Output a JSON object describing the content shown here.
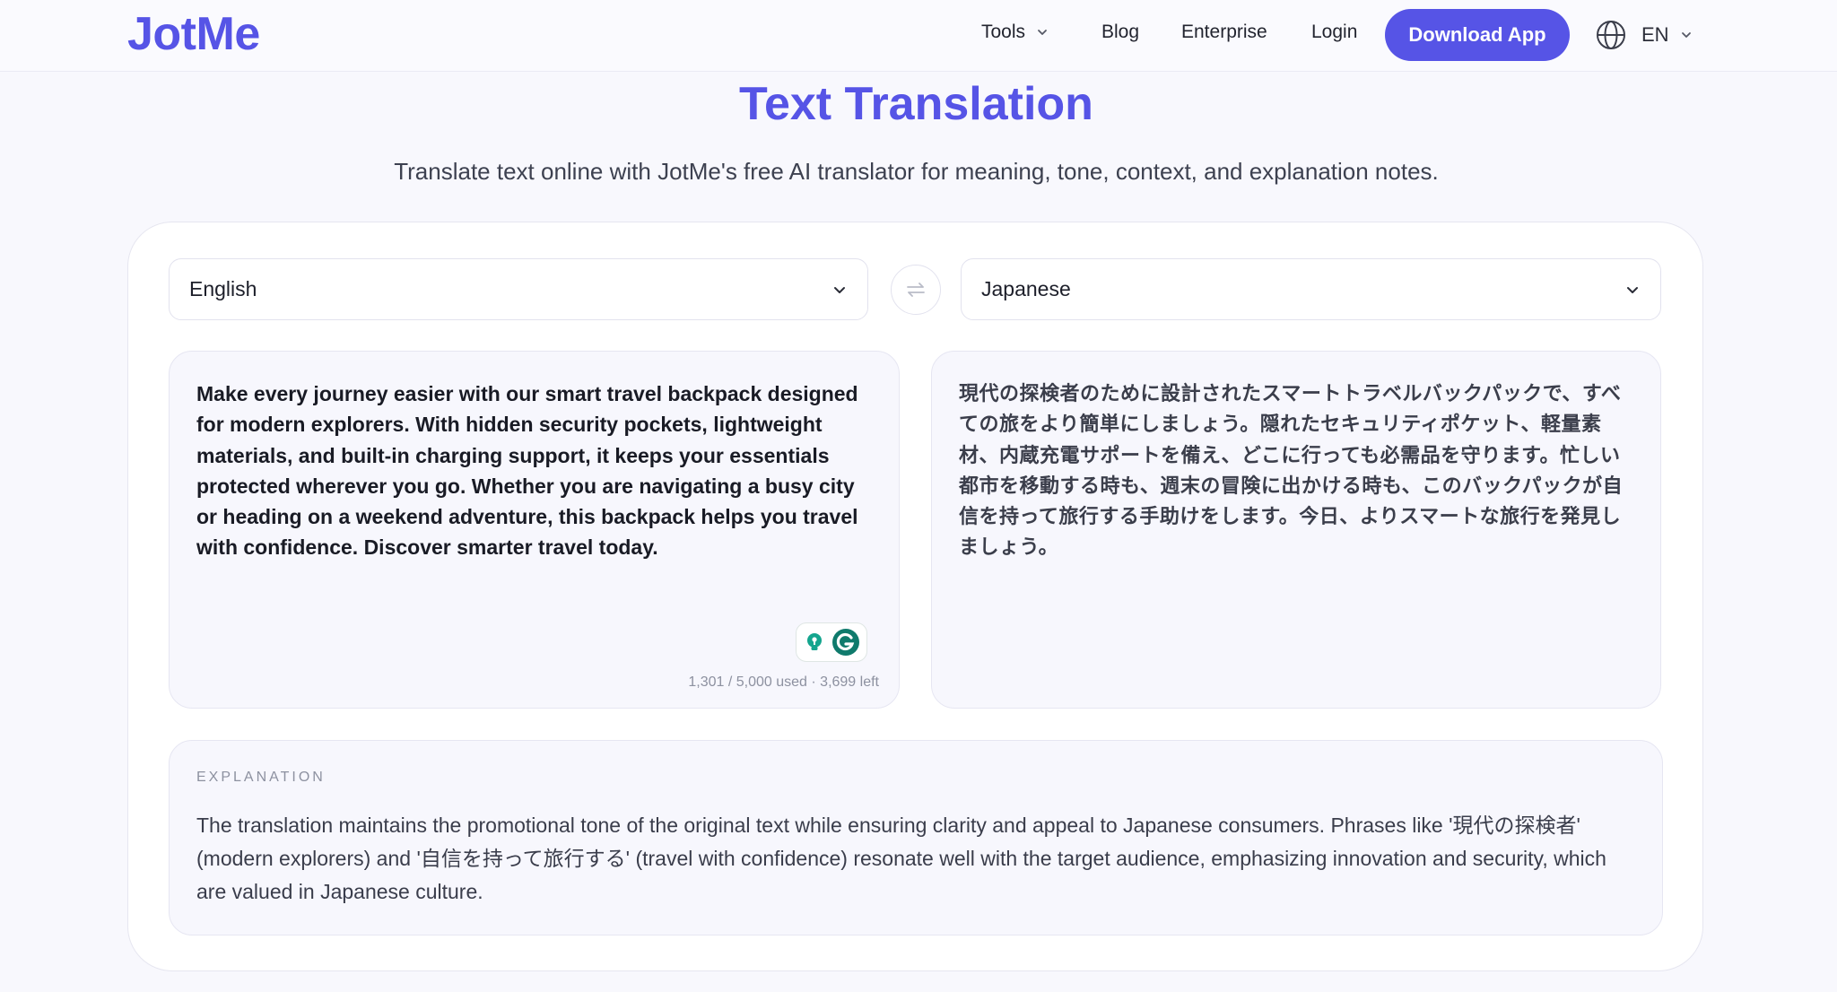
{
  "header": {
    "logo": "JotMe",
    "nav": {
      "tools": "Tools",
      "blog": "Blog",
      "enterprise": "Enterprise",
      "login": "Login"
    },
    "download_label": "Download App",
    "language_code": "EN"
  },
  "hero": {
    "title": "Text Translation",
    "subtitle": "Translate text online with JotMe's free AI translator for meaning, tone, context, and explanation notes."
  },
  "translator": {
    "source_language": "English",
    "target_language": "Japanese",
    "source_text": "Make every journey easier with our smart travel backpack designed for modern explorers. With hidden security pockets, lightweight materials, and built-in charging support, it keeps your essentials protected wherever you go. Whether you are navigating a busy city or heading on a weekend adventure, this backpack helps you travel with confidence. Discover smarter travel today.",
    "target_text": "現代の探検者のために設計されたスマートトラベルバックパックで、すべての旅をより簡単にしましょう。隠れたセキュリティポケット、軽量素材、内蔵充電サポートを備え、どこに行っても必需品を守ります。忙しい都市を移動する時も、週末の冒険に出かける時も、このバックパックが自信を持って旅行する手助けをします。今日、よりスマートな旅行を発見しましょう。",
    "char_count": "1,301 / 5,000 used · 3,699 left"
  },
  "explanation": {
    "heading": "EXPLANATION",
    "body": "The translation maintains the promotional tone of the original text while ensuring clarity and appeal to Japanese consumers. Phrases like '現代の探検者' (modern explorers) and '自信を持って旅行する' (travel with confidence) resonate well with the target audience, emphasizing innovation and security, which are valued in Japanese culture."
  },
  "colors": {
    "brand": "#5654e6",
    "extension_green": "#0f7a6c"
  },
  "icons": {
    "nav_dropdown": "chevron-down-icon",
    "language": "globe-icon",
    "swap": "swap-arrows-icon",
    "extension": [
      "lightbulb-icon",
      "grammarly-icon"
    ]
  }
}
